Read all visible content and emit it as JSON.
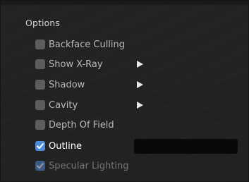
{
  "panel": {
    "title": "Options",
    "items": [
      {
        "label": "Backface Culling",
        "checked": false,
        "submenu": false,
        "disabled": false
      },
      {
        "label": "Show X-Ray",
        "checked": false,
        "submenu": true,
        "disabled": false
      },
      {
        "label": "Shadow",
        "checked": false,
        "submenu": true,
        "disabled": false
      },
      {
        "label": "Cavity",
        "checked": false,
        "submenu": true,
        "disabled": false
      },
      {
        "label": "Depth Of Field",
        "checked": false,
        "submenu": false,
        "disabled": false
      },
      {
        "label": "Outline",
        "checked": true,
        "submenu": false,
        "disabled": false,
        "color": "#0a0a0a"
      },
      {
        "label": "Specular Lighting",
        "checked": true,
        "submenu": false,
        "disabled": true
      }
    ]
  },
  "colors": {
    "checkbox_on": "#4e8bd8",
    "checkbox_off": "#5d5d5d",
    "panel_bg": "#232323"
  },
  "icons": {
    "submenu": "triangle-right-icon",
    "check": "checkmark-icon"
  }
}
